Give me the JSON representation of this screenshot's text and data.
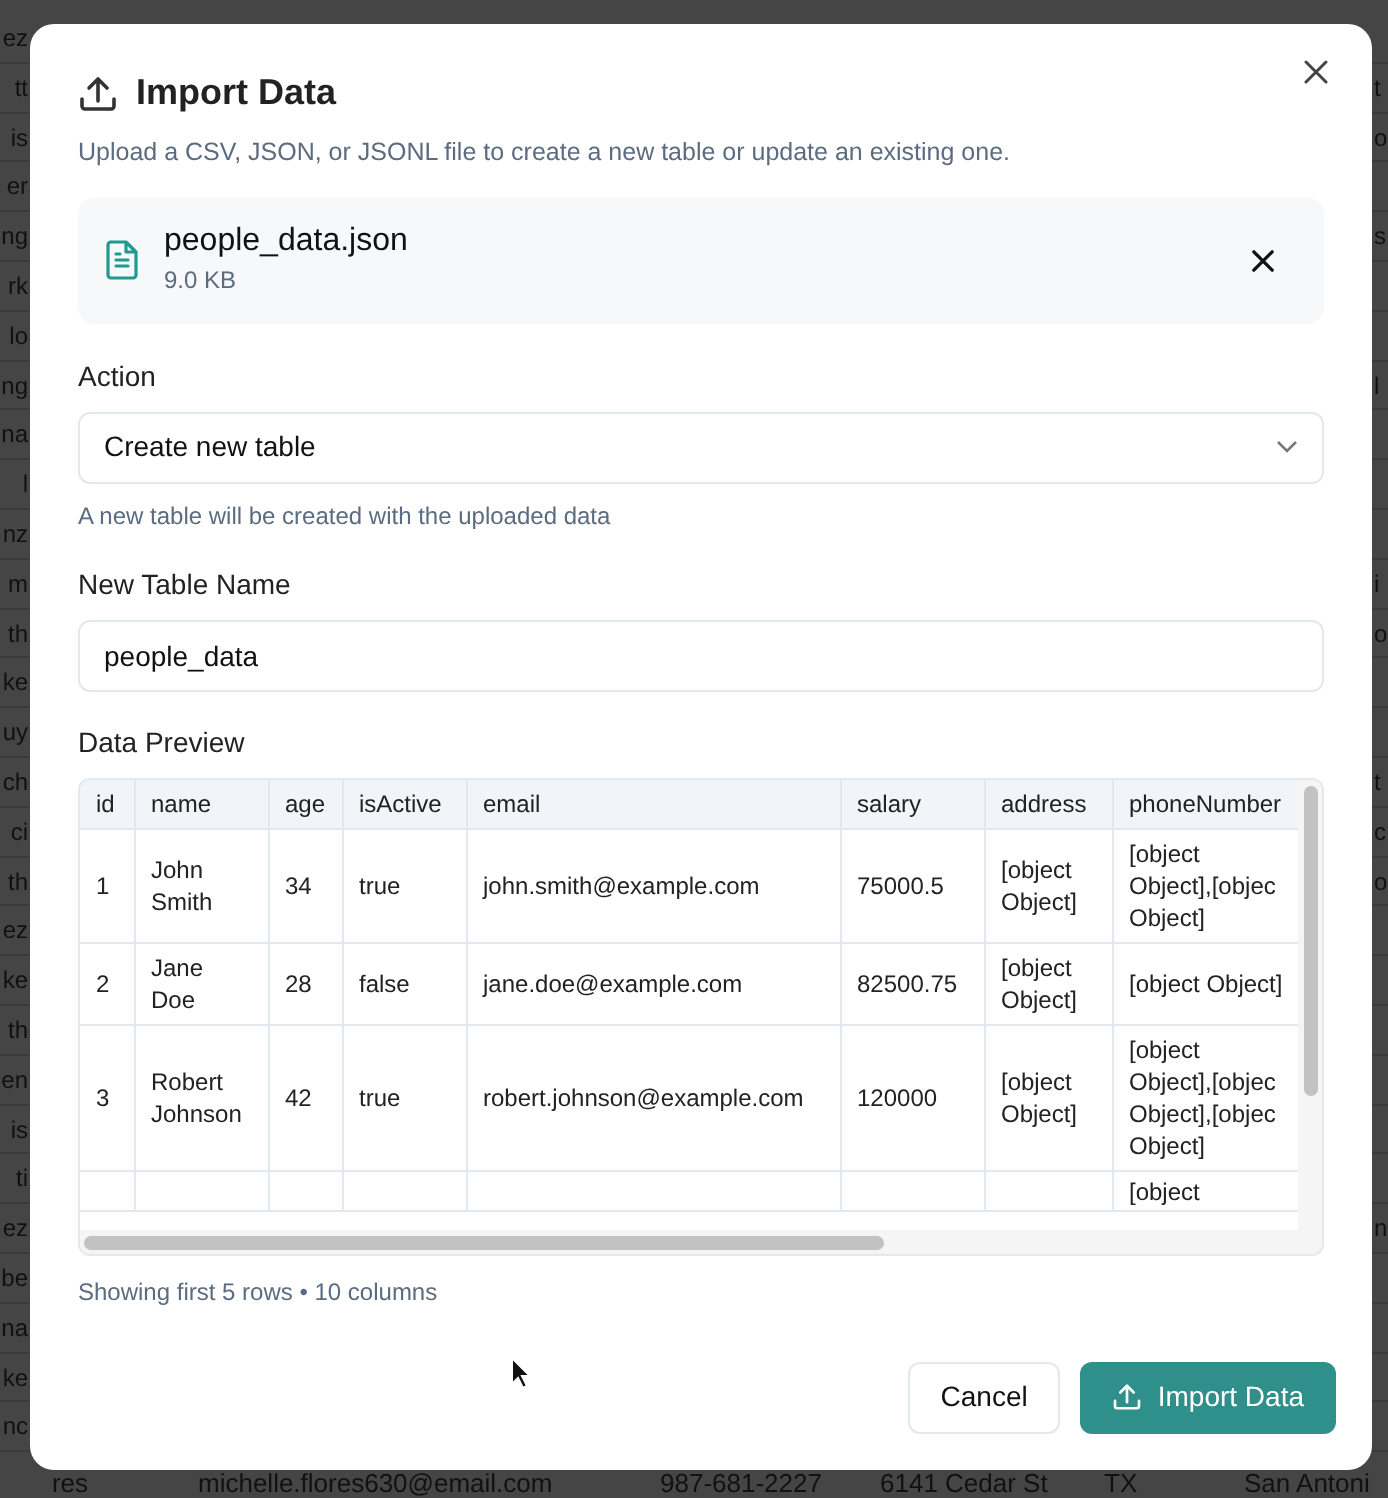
{
  "background_table": {
    "rows": [
      {
        "left": "ez"
      },
      {
        "left": "tt",
        "right": "t"
      },
      {
        "left": "is",
        "right": "o"
      },
      {
        "left": "er"
      },
      {
        "left": "ng",
        "right": "s"
      },
      {
        "left": "rk"
      },
      {
        "left": "lo"
      },
      {
        "left": "ng",
        "right": "l"
      },
      {
        "left": "na"
      },
      {
        "left": "l"
      },
      {
        "left": "nz"
      },
      {
        "left": "m",
        "right": "i"
      },
      {
        "left": "th",
        "right": "o"
      },
      {
        "left": "ke"
      },
      {
        "left": "uy"
      },
      {
        "left": "ch",
        "right": "t"
      },
      {
        "left": "ci",
        "right": "c"
      },
      {
        "left": "th",
        "right": "o"
      },
      {
        "left": "ez"
      },
      {
        "left": "ke"
      },
      {
        "left": "th"
      },
      {
        "left": "en"
      },
      {
        "left": "is"
      },
      {
        "left": "ti"
      },
      {
        "left": "ez",
        "right": "n"
      },
      {
        "left": "be"
      },
      {
        "left": "na"
      },
      {
        "left": "ke"
      },
      {
        "left": "nc"
      }
    ],
    "last_row": [
      "res",
      "michelle.flores630@email.com",
      "987-681-2227",
      "6141 Cedar St",
      "TX",
      "San Antoni"
    ]
  },
  "dialog": {
    "title": "Import Data",
    "description": "Upload a CSV, JSON, or JSONL file to create a new table or update an existing one.",
    "file": {
      "name": "people_data.json",
      "size": "9.0 KB"
    },
    "action": {
      "label": "Action",
      "value": "Create new table",
      "hint": "A new table will be created with the uploaded data"
    },
    "table_name": {
      "label": "New Table Name",
      "value": "people_data"
    },
    "preview": {
      "label": "Data Preview",
      "columns": [
        "id",
        "name",
        "age",
        "isActive",
        "email",
        "salary",
        "address",
        "phoneNumber"
      ],
      "rows": [
        [
          "1",
          "John Smith",
          "34",
          "true",
          "john.smith@example.com",
          "75000.5",
          "[object Object]",
          "[object\nObject],[objec\nObject]"
        ],
        [
          "2",
          "Jane Doe",
          "28",
          "false",
          "jane.doe@example.com",
          "82500.75",
          "[object Object]",
          "[object Object]"
        ],
        [
          "3",
          "Robert Johnson",
          "42",
          "true",
          "robert.johnson@example.com",
          "120000",
          "[object Object]",
          "[object\nObject],[objec\nObject],[objec\nObject]"
        ],
        [
          "",
          "",
          "",
          "",
          "",
          "",
          "",
          "[object"
        ]
      ],
      "footer": "Showing first 5 rows • 10 columns"
    },
    "buttons": [
      {
        "kind": "secondary",
        "label": "Cancel"
      },
      {
        "kind": "primary",
        "label": "Import Data"
      }
    ]
  }
}
